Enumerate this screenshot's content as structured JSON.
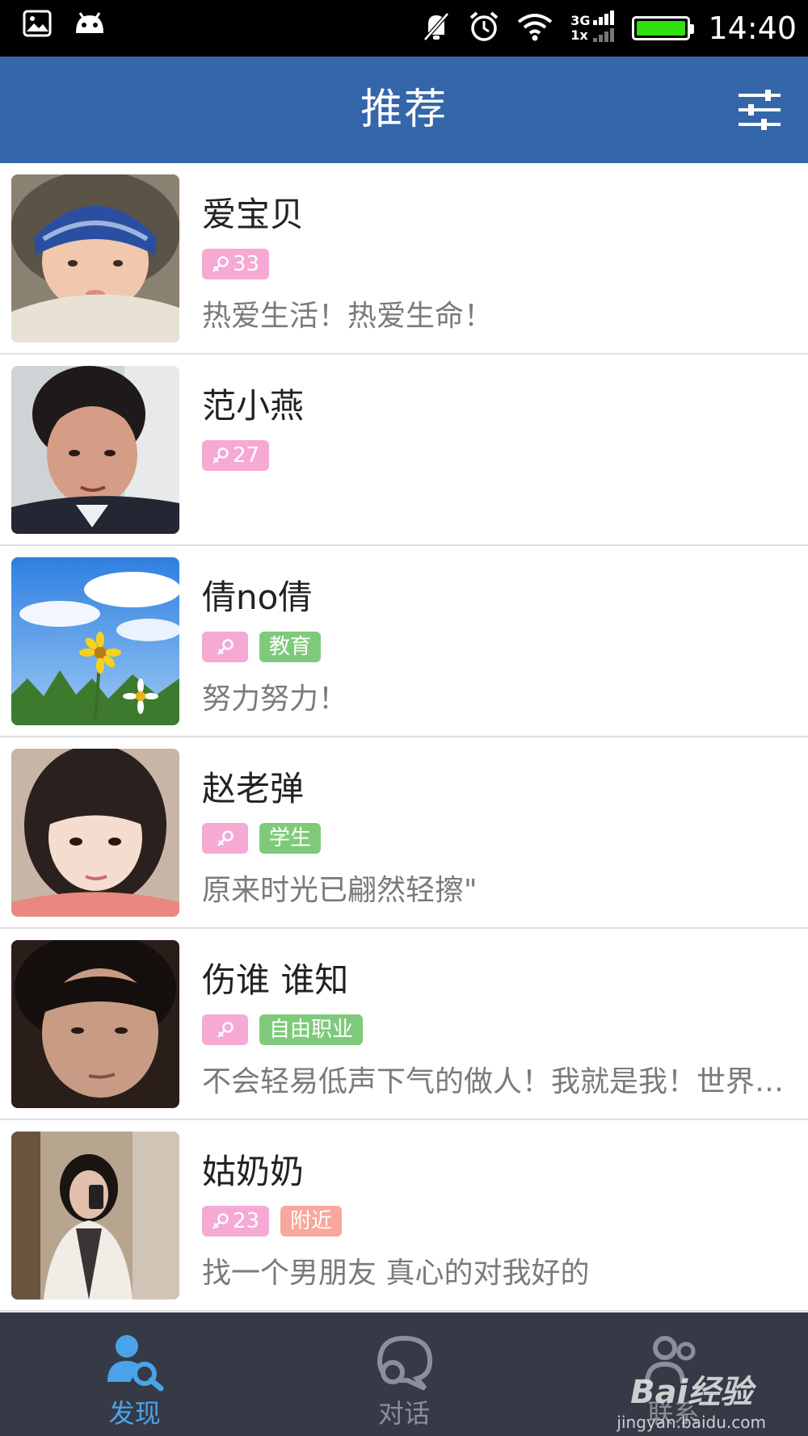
{
  "status_bar": {
    "time": "14:40",
    "network_top": "3G",
    "network_bottom": "1x"
  },
  "header": {
    "title": "推荐"
  },
  "users": [
    {
      "name": "爱宝贝",
      "age": "33",
      "tags": [],
      "signature": "热爱生活！热爱生命！"
    },
    {
      "name": "范小燕",
      "age": "27",
      "tags": [],
      "signature": ""
    },
    {
      "name": "倩no倩",
      "age": "",
      "tags": [
        {
          "label": "教育",
          "kind": "job"
        }
      ],
      "signature": "努力努力！"
    },
    {
      "name": "赵老弹",
      "age": "",
      "tags": [
        {
          "label": "学生",
          "kind": "job"
        }
      ],
      "signature": "原来时光已翩然轻擦\""
    },
    {
      "name": "伤谁 谁知",
      "age": "",
      "tags": [
        {
          "label": "自由职业",
          "kind": "job"
        }
      ],
      "signature": "不会轻易低声下气的做人！我就是我！世界上独一无二的我"
    },
    {
      "name": "姑奶奶",
      "age": "23",
      "tags": [
        {
          "label": "附近",
          "kind": "near"
        }
      ],
      "signature": "找一个男朋友  真心的对我好的"
    }
  ],
  "tabs": [
    {
      "label": "发现",
      "active": true
    },
    {
      "label": "对话",
      "active": false
    },
    {
      "label": "联系",
      "active": false
    }
  ],
  "watermark": {
    "brand": "Bai经验",
    "url": "jingyan.baidu.com"
  },
  "colors": {
    "header": "#3466aa",
    "tabbar": "#353a46",
    "active_tab": "#4aa3e8",
    "female_badge": "#f5a9d3",
    "job_badge": "#7fca7a",
    "near_badge": "#f8a79d"
  }
}
